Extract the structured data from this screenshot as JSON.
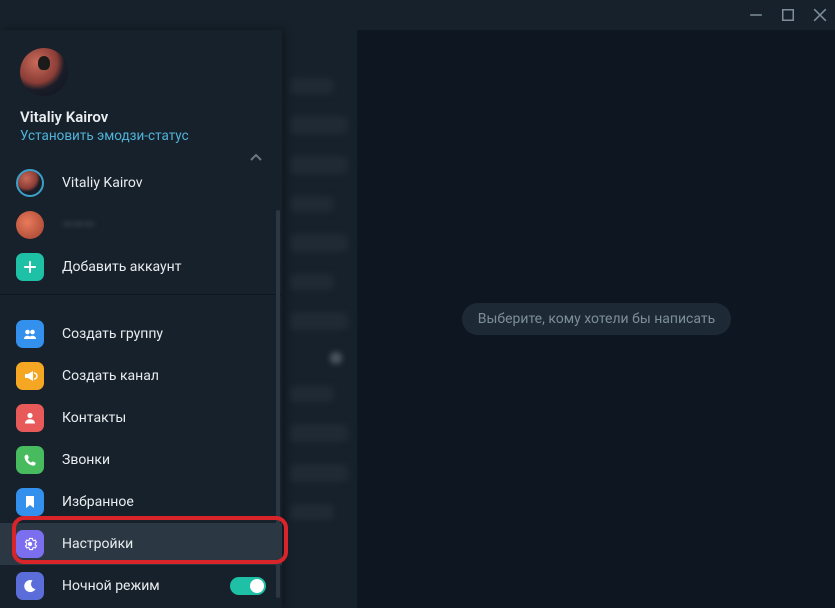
{
  "profile": {
    "username": "Vitaliy Kairov",
    "status_link": "Установить эмодзи-статус"
  },
  "accounts": {
    "current": "Vitaliy Kairov",
    "second_masked": "———",
    "add_label": "Добавить аккаунт"
  },
  "menu": {
    "new_group": "Создать группу",
    "new_channel": "Создать канал",
    "contacts": "Контакты",
    "calls": "Звонки",
    "saved": "Избранное",
    "settings": "Настройки",
    "night_mode": "Ночной режим"
  },
  "content": {
    "placeholder": "Выберите, кому хотели бы написать"
  },
  "colors": {
    "accent": "#3390ec",
    "highlight": "#d9252a",
    "toggle_on": "#1ec1a6"
  }
}
